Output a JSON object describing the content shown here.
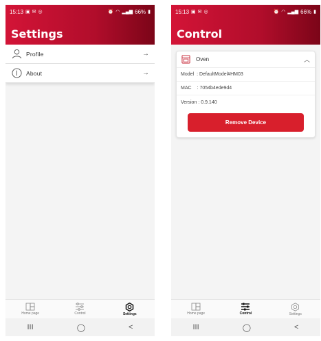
{
  "left": {
    "status": {
      "time": "15:13",
      "battery": "66%"
    },
    "title": "Settings",
    "items": [
      {
        "label": "Profile",
        "icon": "person-icon"
      },
      {
        "label": "About",
        "icon": "info-icon"
      }
    ],
    "nav": [
      {
        "label": "Home page",
        "icon": "home-icon",
        "active": false
      },
      {
        "label": "Control",
        "icon": "sliders-icon",
        "active": false
      },
      {
        "label": "Settings",
        "icon": "gear-icon",
        "active": true
      }
    ]
  },
  "right": {
    "status": {
      "time": "15:13",
      "battery": "66%"
    },
    "title": "Control",
    "device": {
      "name": "Oven",
      "model_label": "Model",
      "model_value": ": DefaultModel#HM03",
      "mac_label": "MAC",
      "mac_value": ": 7054b4ede9d4",
      "version_label": "Version",
      "version_value": ": 0.9.140",
      "remove_label": "Remove Device"
    },
    "nav": [
      {
        "label": "Home page",
        "icon": "home-icon",
        "active": false
      },
      {
        "label": "Control",
        "icon": "sliders-icon",
        "active": true
      },
      {
        "label": "Settings",
        "icon": "gear-icon",
        "active": false
      }
    ]
  },
  "system_nav": {
    "recent": "III",
    "home": "◯",
    "back": "<"
  },
  "colors": {
    "header_start": "#d31437",
    "header_end": "#7b0518",
    "button": "#d81f2c"
  }
}
